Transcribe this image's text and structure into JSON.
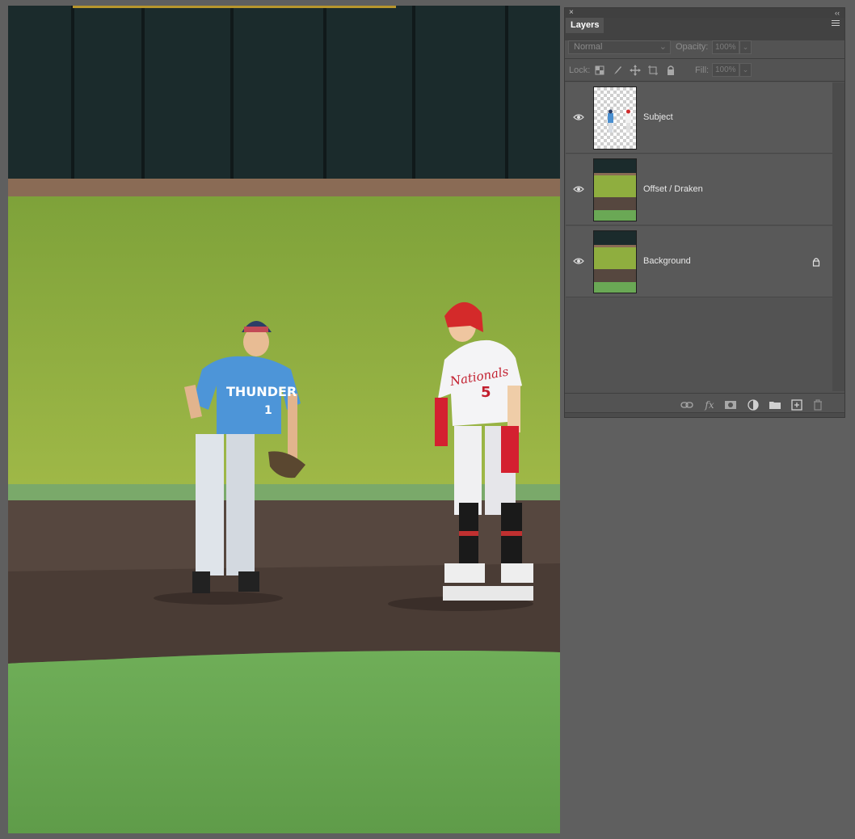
{
  "panel": {
    "close_glyph": "×",
    "collapse_glyph": "‹‹",
    "tab_label": "Layers",
    "blend_mode": "Normal",
    "opacity_label": "Opacity:",
    "opacity_value": "100%",
    "lock_label": "Lock:",
    "fill_label": "Fill:",
    "fill_value": "100%"
  },
  "layers": [
    {
      "name": "Subject",
      "visible": true,
      "locked": false,
      "thumbnail": "transparent-subject"
    },
    {
      "name": "Offset / Draken",
      "visible": true,
      "locked": false,
      "thumbnail": "field"
    },
    {
      "name": "Background",
      "visible": true,
      "locked": true,
      "thumbnail": "field"
    }
  ],
  "canvas": {
    "player_left_jersey": "THUNDER",
    "player_left_number": "1",
    "player_right_jersey": "Nationals",
    "player_right_number": "5"
  },
  "footer_icons": [
    "link-icon",
    "fx-icon",
    "mask-icon",
    "adjustment-icon",
    "folder-icon",
    "new-layer-icon",
    "trash-icon"
  ]
}
